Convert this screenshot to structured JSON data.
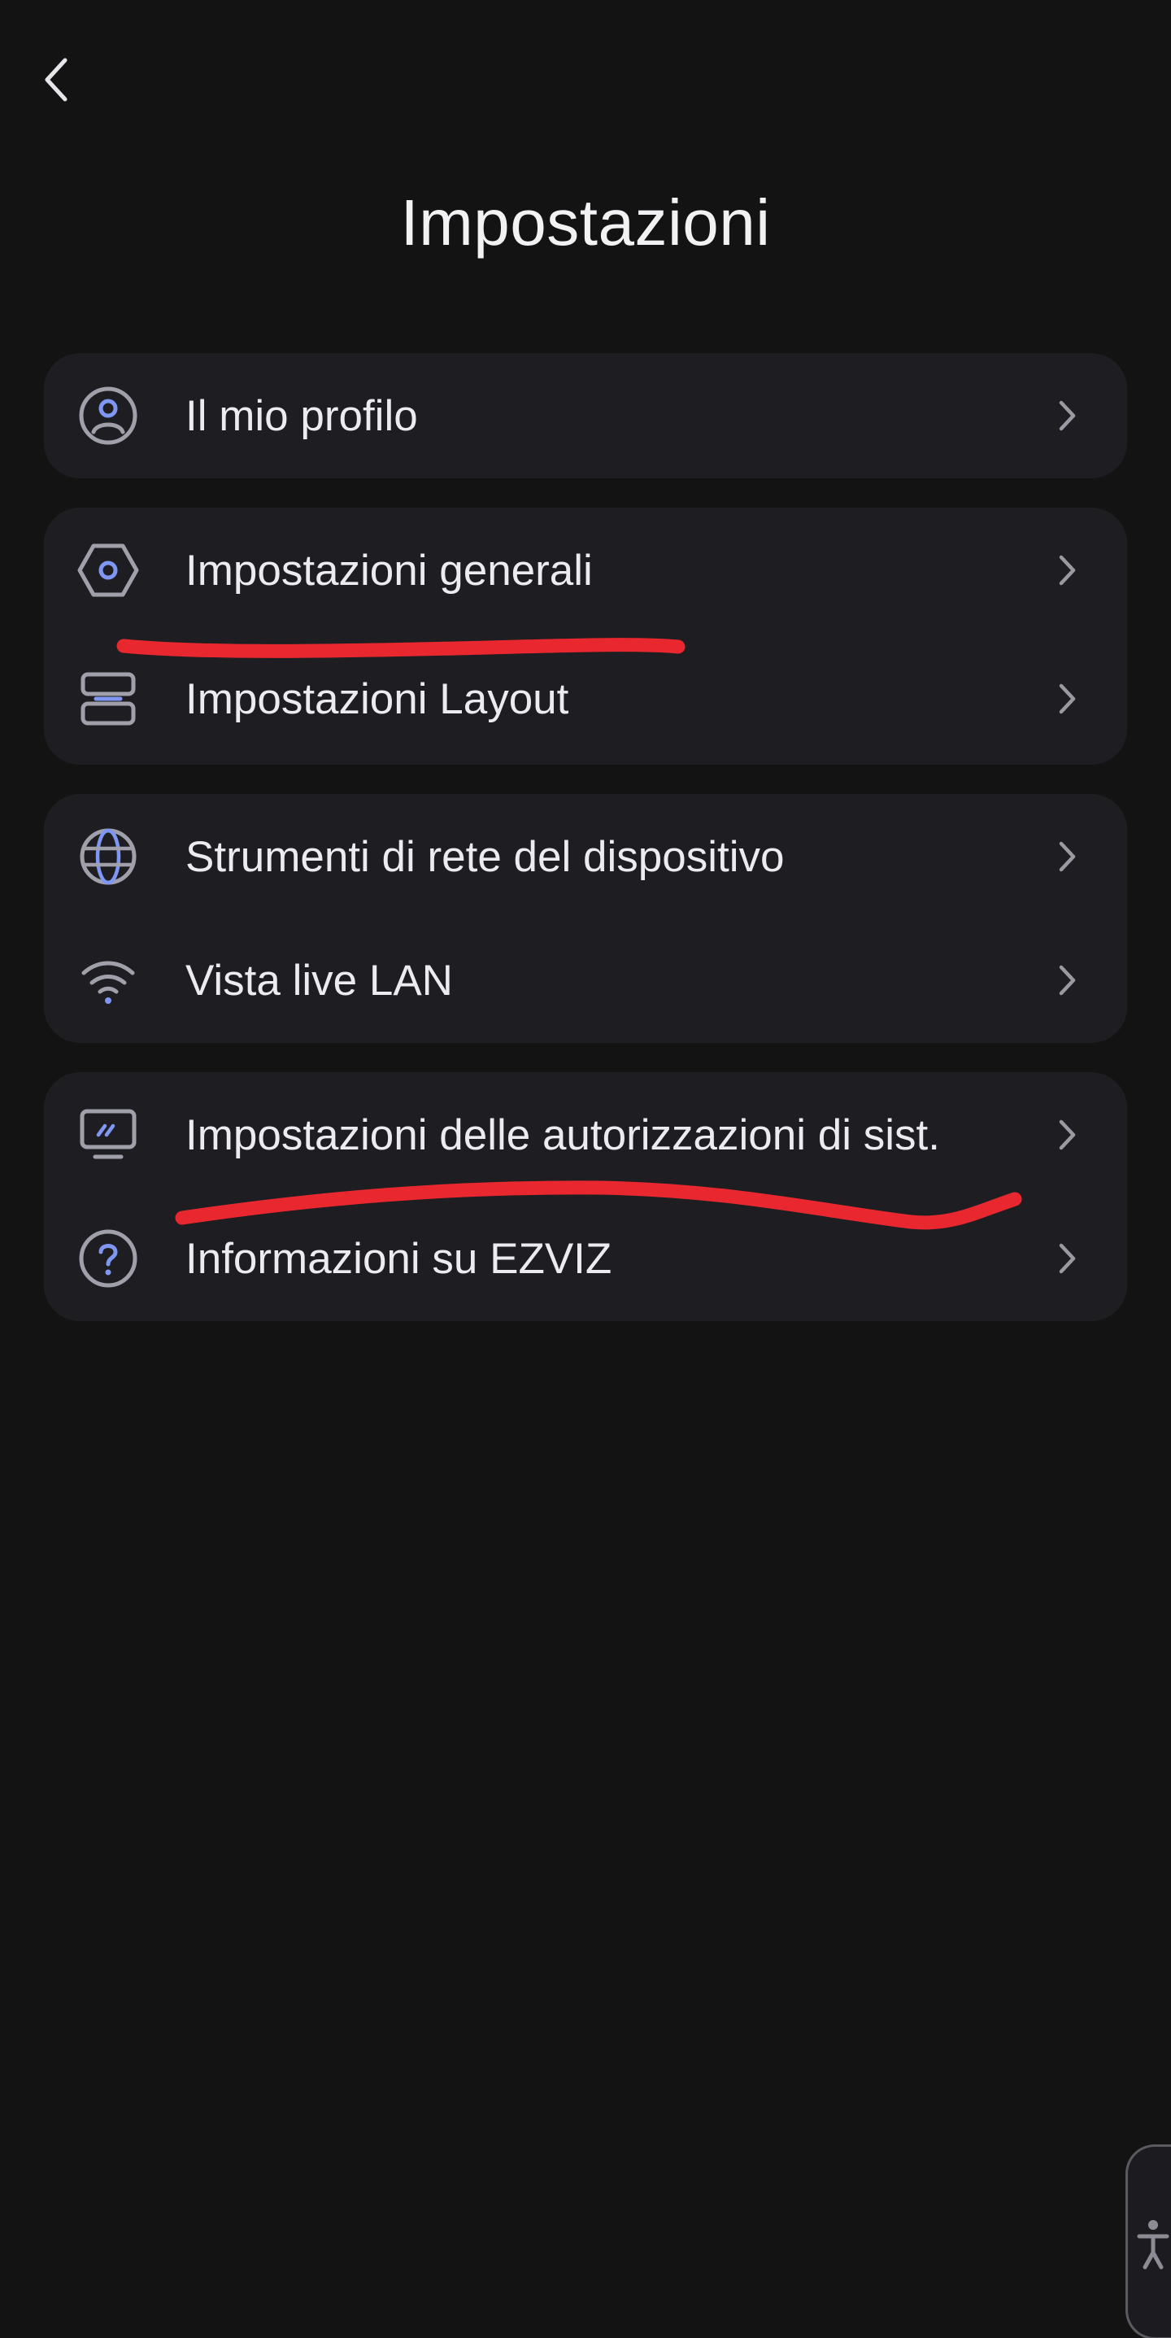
{
  "header": {
    "title": "Impostazioni",
    "back_icon": "chevron-left-icon"
  },
  "groups": [
    {
      "items": [
        {
          "label": "Il mio profilo",
          "icon": "profile-icon"
        }
      ]
    },
    {
      "items": [
        {
          "label": "Impostazioni generali",
          "icon": "hexagon-settings-icon"
        },
        {
          "label": "Impostazioni Layout",
          "icon": "layout-icon"
        }
      ]
    },
    {
      "items": [
        {
          "label": "Strumenti di rete del dispositivo",
          "icon": "globe-icon"
        },
        {
          "label": "Vista live LAN",
          "icon": "wifi-icon"
        }
      ]
    },
    {
      "items": [
        {
          "label": "Impostazioni delle autorizzazioni di sist.",
          "icon": "monitor-icon"
        },
        {
          "label": "Informazioni su EZVIZ",
          "icon": "help-icon"
        }
      ]
    }
  ],
  "annotations": {
    "underline_color": "#e8282e",
    "underlined_items": [
      "Impostazioni generali",
      "Impostazioni delle autorizzazioni di sist."
    ]
  },
  "accessibility": {
    "icon": "accessibility-icon"
  },
  "colors": {
    "background": "#131313",
    "card": "#1e1e22",
    "icon_gray": "#a0a0aa",
    "icon_accent": "#7f97f2",
    "text": "#ececf0"
  }
}
